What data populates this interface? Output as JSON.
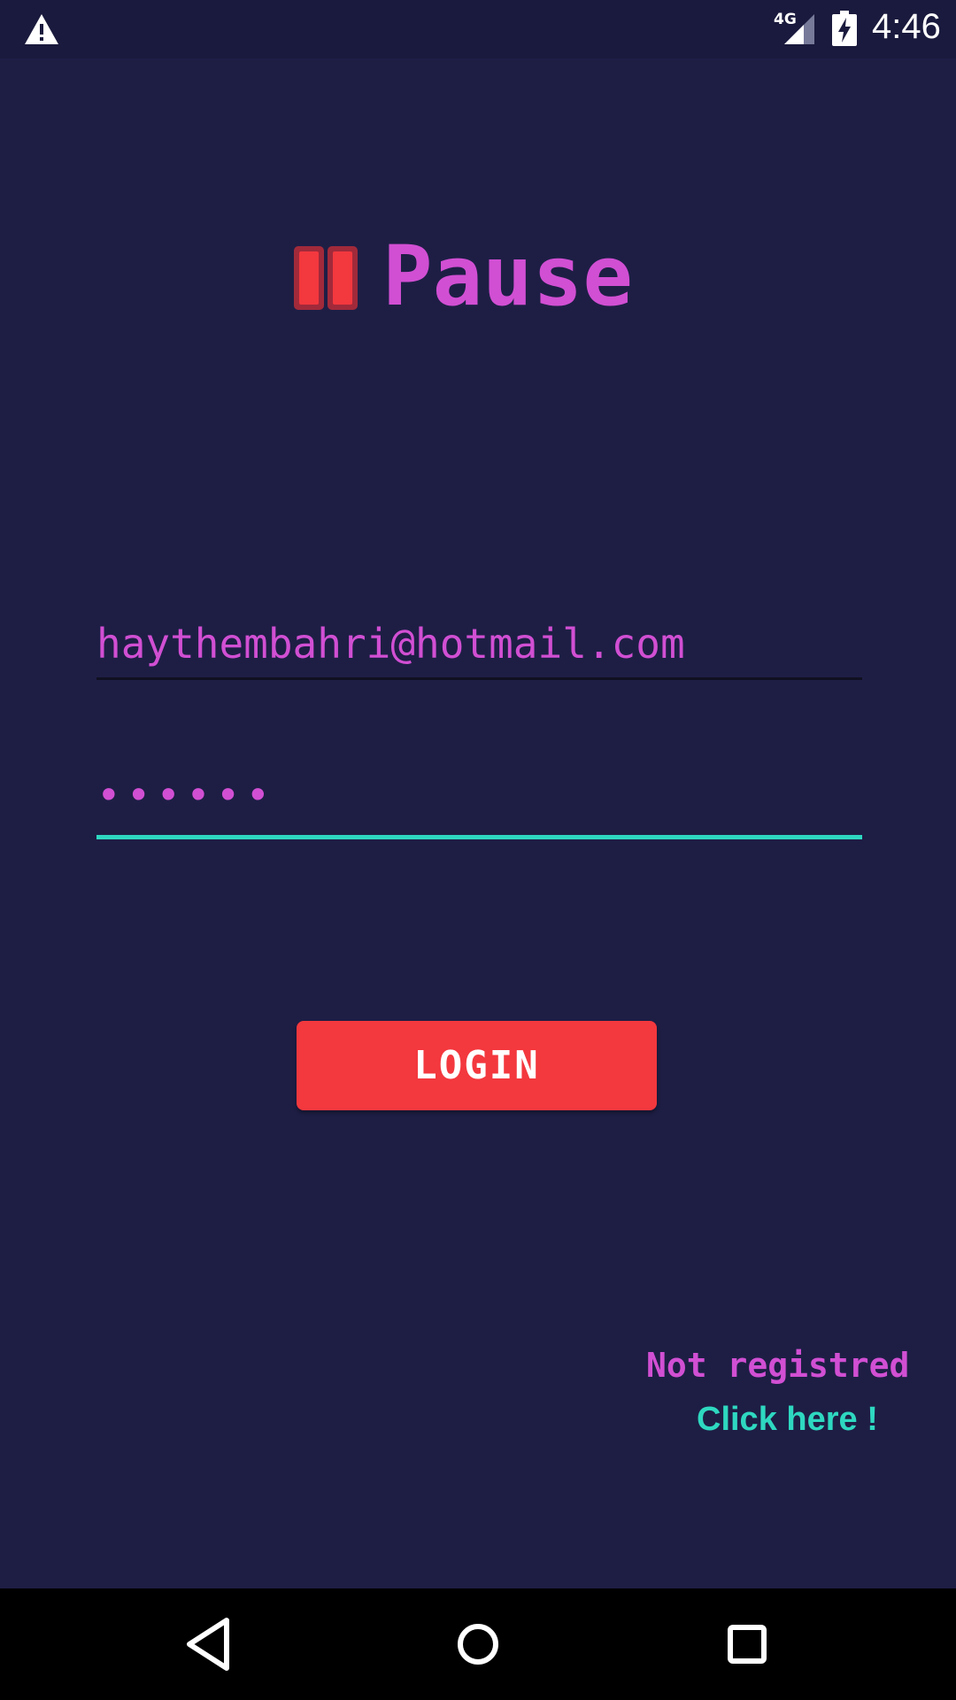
{
  "status_bar": {
    "network": "4G",
    "time": "4:46",
    "icons": [
      "warning-icon",
      "signal-icon",
      "battery-charging-icon"
    ]
  },
  "app": {
    "title": "Pause",
    "logo_icon": "pause-icon"
  },
  "login_form": {
    "email_value": "haythembahri@hotmail.com",
    "password_value": "••••••",
    "login_label": "LOGIN"
  },
  "register": {
    "prompt": "Not registred",
    "link_label": "Click here !"
  },
  "nav_bar": {
    "icons": [
      "back-icon",
      "home-icon",
      "recents-icon"
    ]
  },
  "colors": {
    "background": "#1e1e45",
    "accent_pink": "#d14fd3",
    "accent_teal": "#2ed8c0",
    "button_red": "#f3383e"
  }
}
